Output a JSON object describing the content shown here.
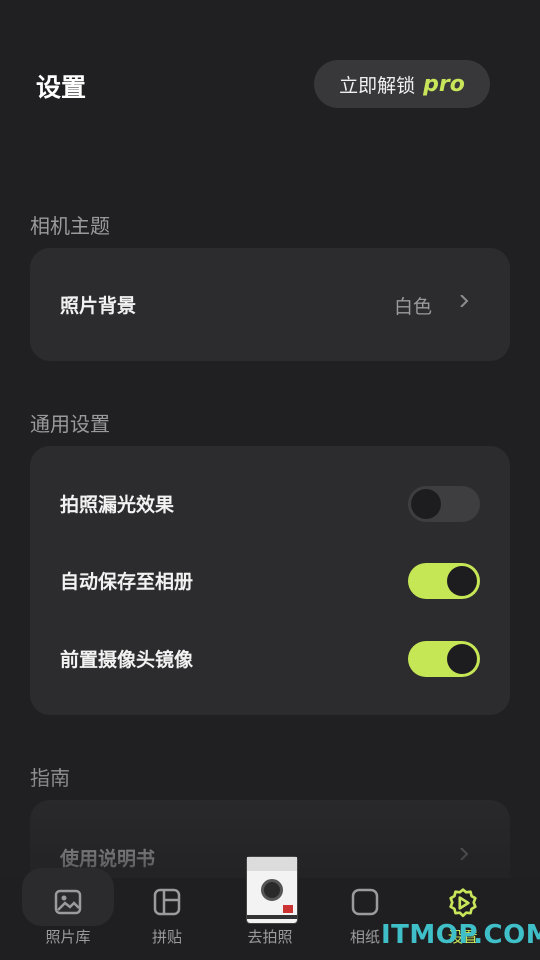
{
  "header": {
    "title": "设置",
    "unlock_label": "立即解锁",
    "pro_label": "pro"
  },
  "sections": {
    "camera_theme": {
      "label": "相机主题",
      "photo_bg": {
        "name": "照片背景",
        "value": "白色"
      }
    },
    "general": {
      "label": "通用设置",
      "items": [
        {
          "name": "拍照漏光效果",
          "enabled": false
        },
        {
          "name": "自动保存至相册",
          "enabled": true
        },
        {
          "name": "前置摄像头镜像",
          "enabled": true
        }
      ]
    },
    "guide": {
      "label": "指南",
      "manual": {
        "name": "使用说明书"
      }
    }
  },
  "tabs": [
    {
      "label": "照片库",
      "icon": "photo-icon"
    },
    {
      "label": "拼贴",
      "icon": "collage-icon"
    },
    {
      "label": "去拍照",
      "icon": "camera-icon"
    },
    {
      "label": "相纸",
      "icon": "paper-icon"
    },
    {
      "label": "设置",
      "icon": "settings-icon",
      "active": true
    }
  ],
  "watermark": "ITMOP.COM",
  "colors": {
    "accent": "#c5e655",
    "background": "#202022",
    "card": "#2c2c2e"
  }
}
